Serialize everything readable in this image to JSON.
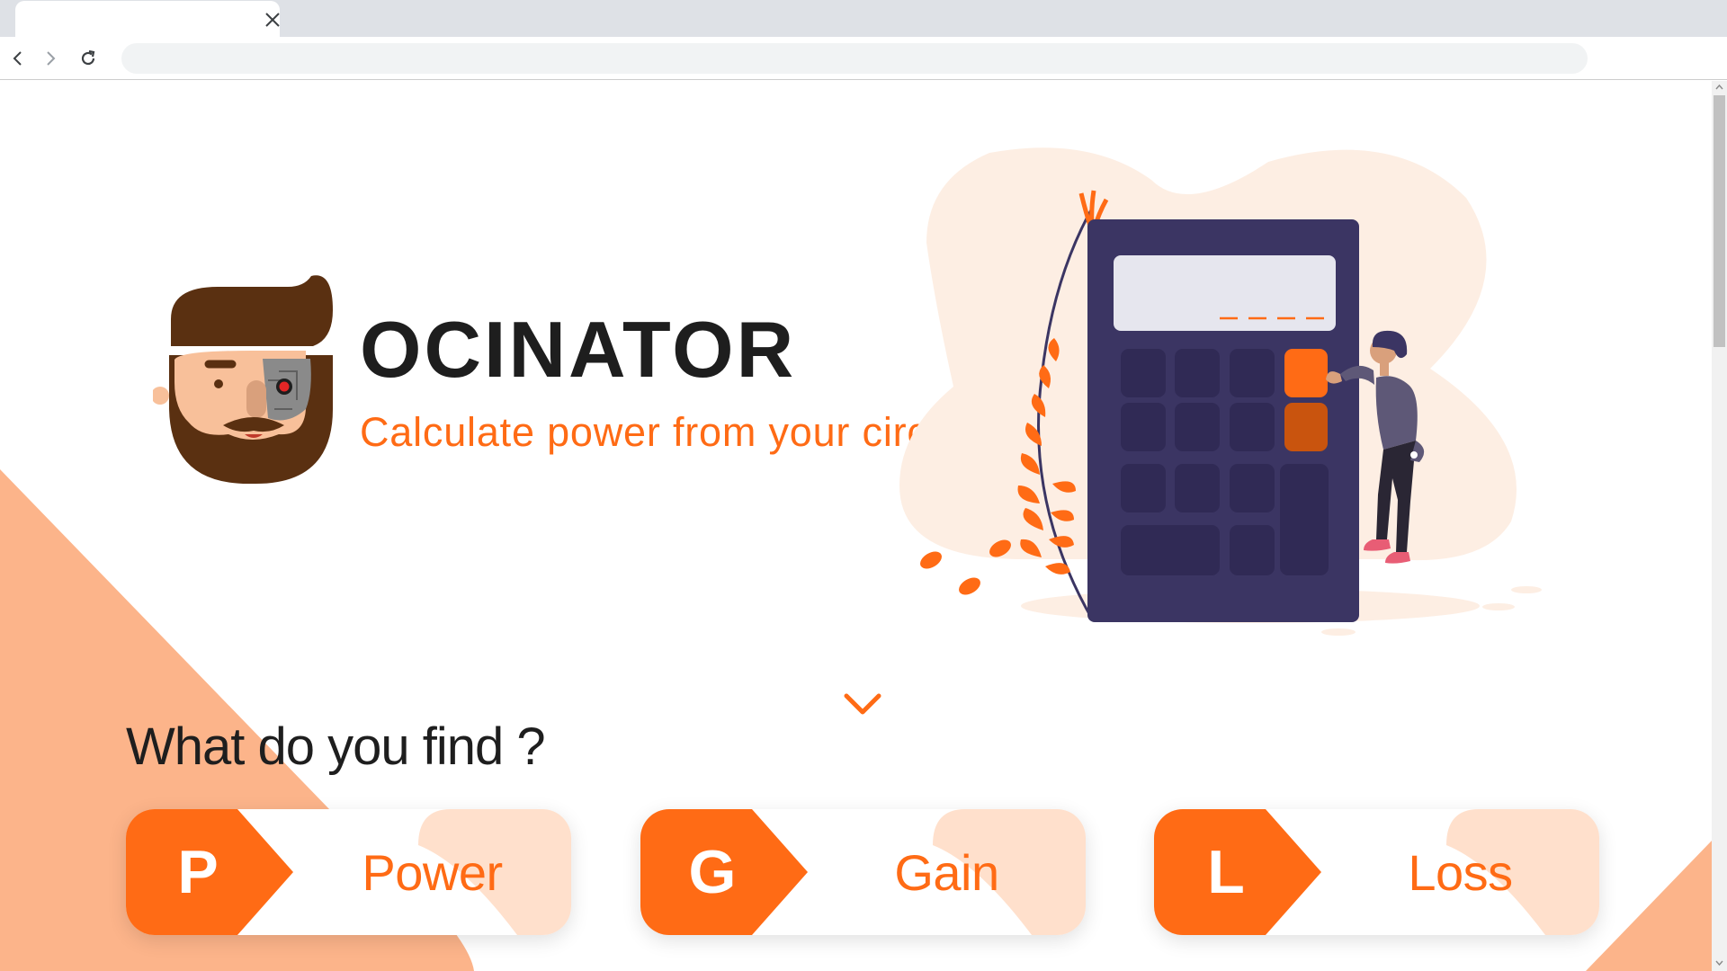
{
  "browser": {
    "tab_close_icon": "close-icon",
    "back_icon": "chevron-left-icon",
    "forward_icon": "chevron-right-icon",
    "reload_icon": "reload-icon",
    "address_value": ""
  },
  "hero": {
    "title": "OCINATOR",
    "tagline": "Calculate power from your circuit",
    "scroll_icon": "chevron-down-icon"
  },
  "section": {
    "title": "What do you find ?"
  },
  "cards": [
    {
      "letter": "P",
      "label": "Power"
    },
    {
      "letter": "G",
      "label": "Gain"
    },
    {
      "letter": "L",
      "label": "Loss"
    }
  ],
  "colors": {
    "accent": "#ff6b15",
    "accent_dark": "#c9540e",
    "peach": "#fcb48a",
    "peach_light": "#ffe0cc",
    "calculator": "#3b3563",
    "text": "#1e1e1e"
  }
}
